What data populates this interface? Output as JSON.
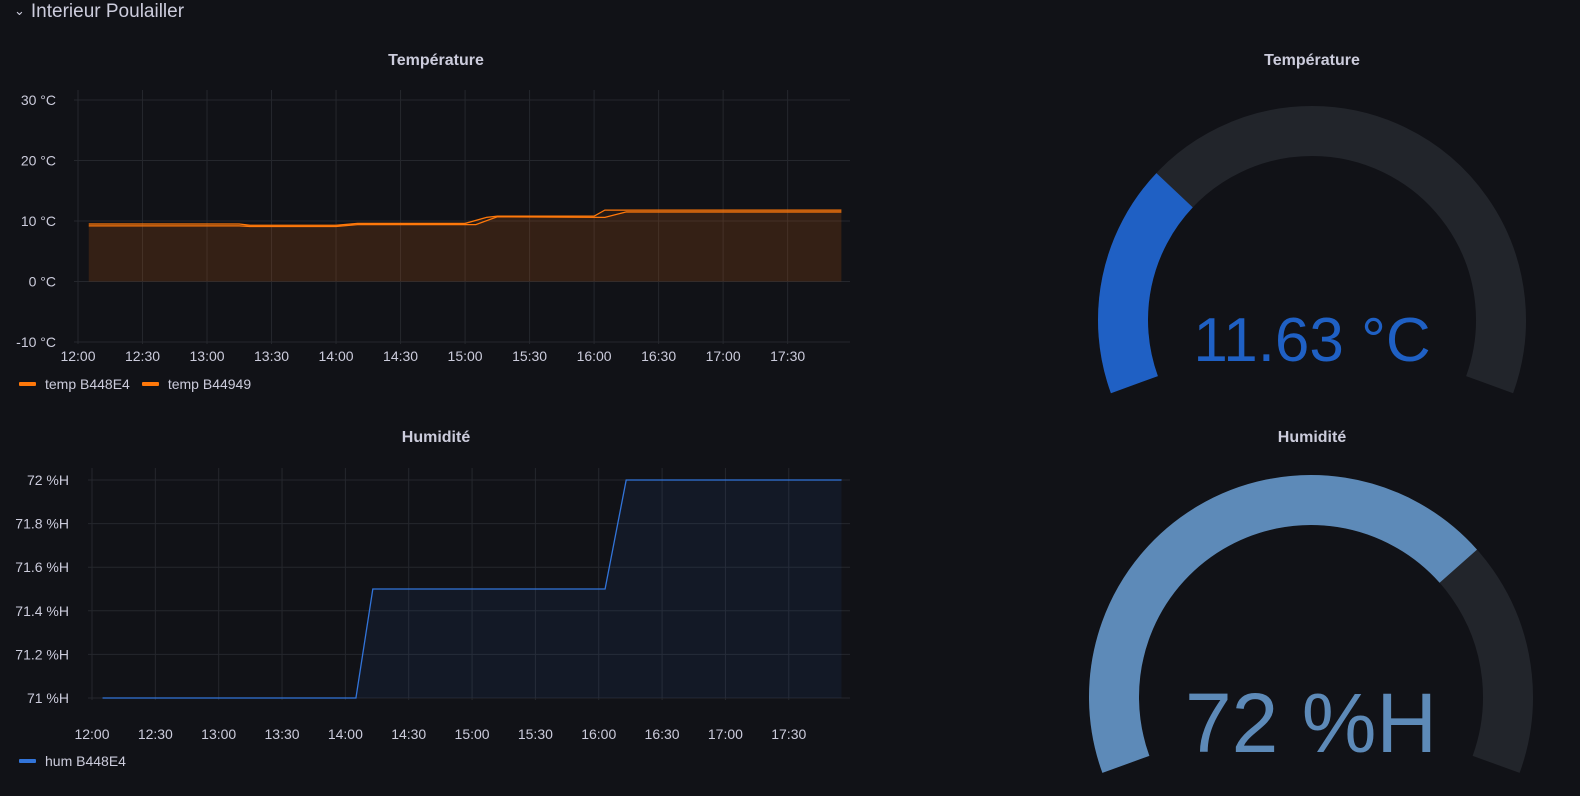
{
  "row": {
    "title": "Interieur Poulailler",
    "collapse_icon": "chevron-down-icon"
  },
  "panels": {
    "temp_graph": {
      "title": "Température"
    },
    "temp_gauge": {
      "title": "Température",
      "value": "11.63 °C",
      "fraction": 0.288,
      "color": "#1f60c4"
    },
    "hum_graph": {
      "title": "Humidité"
    },
    "hum_gauge": {
      "title": "Humidité",
      "value": "72 %H",
      "fraction": 0.72,
      "color": "#5d8ab8"
    }
  },
  "chart_data": [
    {
      "type": "line",
      "title": "Température",
      "x_ticks": [
        "12:00",
        "12:30",
        "13:00",
        "13:30",
        "14:00",
        "14:30",
        "15:00",
        "15:30",
        "16:00",
        "16:30",
        "17:00",
        "17:30"
      ],
      "y_ticks": [
        "30 °C",
        "20 °C",
        "10 °C",
        "0 °C",
        "-10 °C"
      ],
      "ylim": [
        -10,
        30
      ],
      "grid": true,
      "legend_position": "bottom-left",
      "series": [
        {
          "name": "temp B448E4",
          "color": "#ff780a",
          "points": [
            [
              "12:05",
              9.5
            ],
            [
              "13:15",
              9.5
            ],
            [
              "13:20",
              9.3
            ],
            [
              "14:00",
              9.3
            ],
            [
              "14:10",
              9.6
            ],
            [
              "15:00",
              9.6
            ],
            [
              "15:10",
              10.6
            ],
            [
              "15:15",
              10.8
            ],
            [
              "16:00",
              10.8
            ],
            [
              "16:05",
              11.8
            ],
            [
              "17:55",
              11.8
            ]
          ]
        },
        {
          "name": "temp B44949",
          "color": "#ff780a",
          "points": [
            [
              "12:05",
              9.2
            ],
            [
              "13:15",
              9.2
            ],
            [
              "13:20",
              9.1
            ],
            [
              "14:00",
              9.1
            ],
            [
              "14:10",
              9.4
            ],
            [
              "15:05",
              9.4
            ],
            [
              "15:15",
              10.7
            ],
            [
              "16:05",
              10.6
            ],
            [
              "16:15",
              11.5
            ],
            [
              "17:55",
              11.5
            ]
          ]
        }
      ]
    },
    {
      "type": "line",
      "title": "Humidité",
      "x_ticks": [
        "12:00",
        "12:30",
        "13:00",
        "13:30",
        "14:00",
        "14:30",
        "15:00",
        "15:30",
        "16:00",
        "16:30",
        "17:00",
        "17:30"
      ],
      "y_ticks": [
        "72 %H",
        "71.8 %H",
        "71.6 %H",
        "71.4 %H",
        "71.2 %H",
        "71 %H"
      ],
      "ylim": [
        71,
        72
      ],
      "grid": true,
      "legend_position": "bottom-left",
      "series": [
        {
          "name": "hum B448E4",
          "color": "#3274d9",
          "points": [
            [
              "12:05",
              71.0
            ],
            [
              "14:05",
              71.0
            ],
            [
              "14:13",
              71.5
            ],
            [
              "16:03",
              71.5
            ],
            [
              "16:13",
              72.0
            ],
            [
              "17:55",
              72.0
            ]
          ]
        }
      ]
    }
  ]
}
